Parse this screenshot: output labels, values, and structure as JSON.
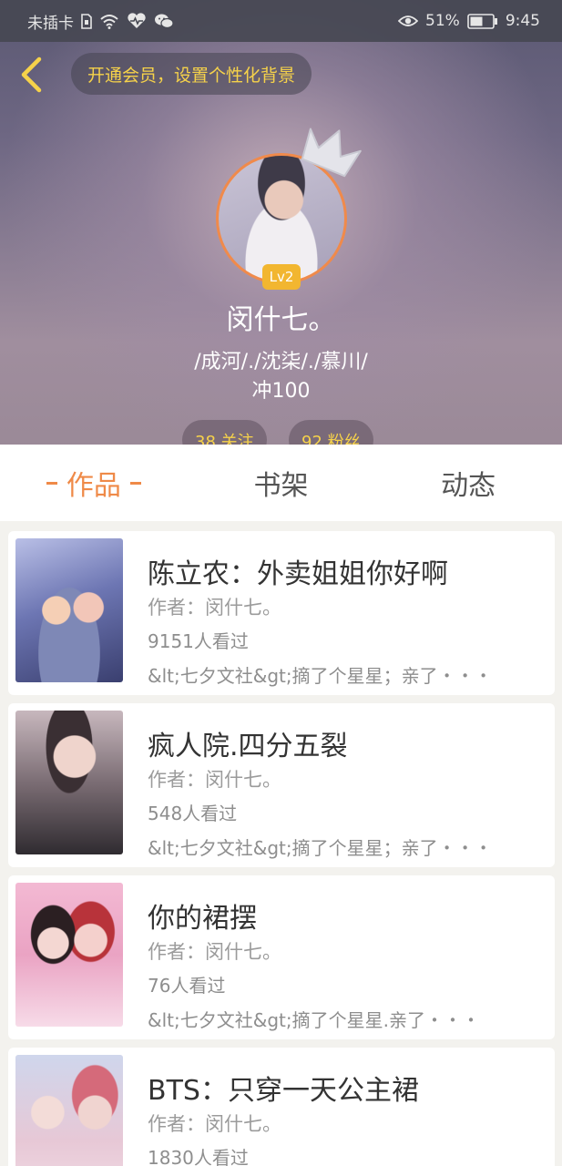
{
  "status_bar": {
    "carrier": "未插卡",
    "battery": "51%",
    "time": "9:45"
  },
  "header": {
    "vip_prompt": "开通会员，设置个性化背景",
    "level": "Lv2",
    "username": "闵什七。",
    "signature_line1": "/成河/./沈柒/./慕川/",
    "signature_line2": "冲100",
    "following": "38 关注",
    "followers": "92 粉丝"
  },
  "tabs": [
    {
      "label": "作品",
      "active": true
    },
    {
      "label": "书架",
      "active": false
    },
    {
      "label": "动态",
      "active": false
    }
  ],
  "works": [
    {
      "title": "陈立农：外卖姐姐你好啊",
      "author": "作者：闵什七。",
      "views": "9151人看过",
      "desc": "&lt;七夕文社&gt;摘了个星星；亲了・・・"
    },
    {
      "title": "疯人院.四分五裂",
      "author": "作者：闵什七。",
      "views": "548人看过",
      "desc": "&lt;七夕文社&gt;摘了个星星；亲了・・・"
    },
    {
      "title": "你的裙摆",
      "author": "作者：闵什七。",
      "views": "76人看过",
      "desc": "&lt;七夕文社&gt;摘了个星星.亲了・・・"
    },
    {
      "title": "BTS：只穿一天公主裙",
      "author": "作者：闵什七。",
      "views": "1830人看过",
      "desc": ""
    }
  ],
  "colors": {
    "accent": "#ef8a48",
    "gold": "#f6d24a",
    "level_badge": "#f2b630"
  },
  "icons": [
    "back-arrow-icon",
    "sim-icon",
    "wifi-icon",
    "heart-pulse-icon",
    "wechat-icon",
    "eye-icon",
    "battery-icon",
    "crown-icon"
  ]
}
